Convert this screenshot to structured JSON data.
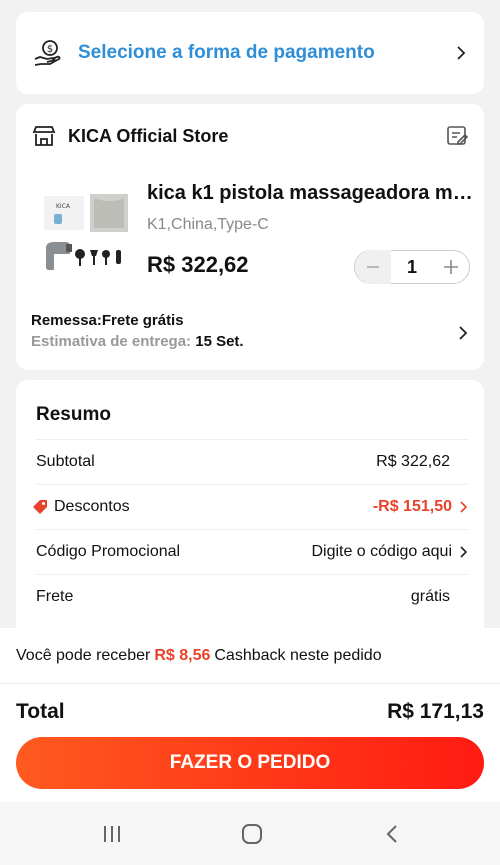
{
  "payment": {
    "label": "Selecione a forma de pagamento",
    "icon": "hand-coin-icon"
  },
  "store": {
    "name": "KICA Official Store",
    "icons": {
      "store": "store-icon",
      "note": "edit-note-icon"
    },
    "product": {
      "title": "kica k1 pistola massageadora mas...",
      "variant": "K1,China,Type-C",
      "price": "R$ 322,62",
      "quantity": "1",
      "image_brand": "KICA"
    },
    "shipping": {
      "label": "Remessa:Frete grátis",
      "estimate_label": "Estimativa de entrega:",
      "estimate_value": "15 Set."
    }
  },
  "summary": {
    "title": "Resumo",
    "rows": [
      {
        "label": "Subtotal",
        "value": "R$ 322,62"
      },
      {
        "label": "Descontos",
        "value": "-R$ 151,50"
      },
      {
        "label": "Código Promocional",
        "value": "Digite o código aqui"
      },
      {
        "label": "Frete",
        "value": "grátis"
      }
    ]
  },
  "cashback": {
    "prefix": "Você pode receber",
    "amount": "R$ 8,56",
    "suffix": "Cashback neste pedido"
  },
  "total": {
    "label": "Total",
    "value": "R$ 171,13"
  },
  "order_button": "FAZER O PEDIDO",
  "colors": {
    "accent": "#e8432a",
    "link_blue": "#2f8fd6",
    "button_start": "#ff5a1f",
    "button_end": "#ff1b12"
  },
  "nav": {
    "icons": [
      "recents-icon",
      "home-icon",
      "back-icon"
    ]
  }
}
